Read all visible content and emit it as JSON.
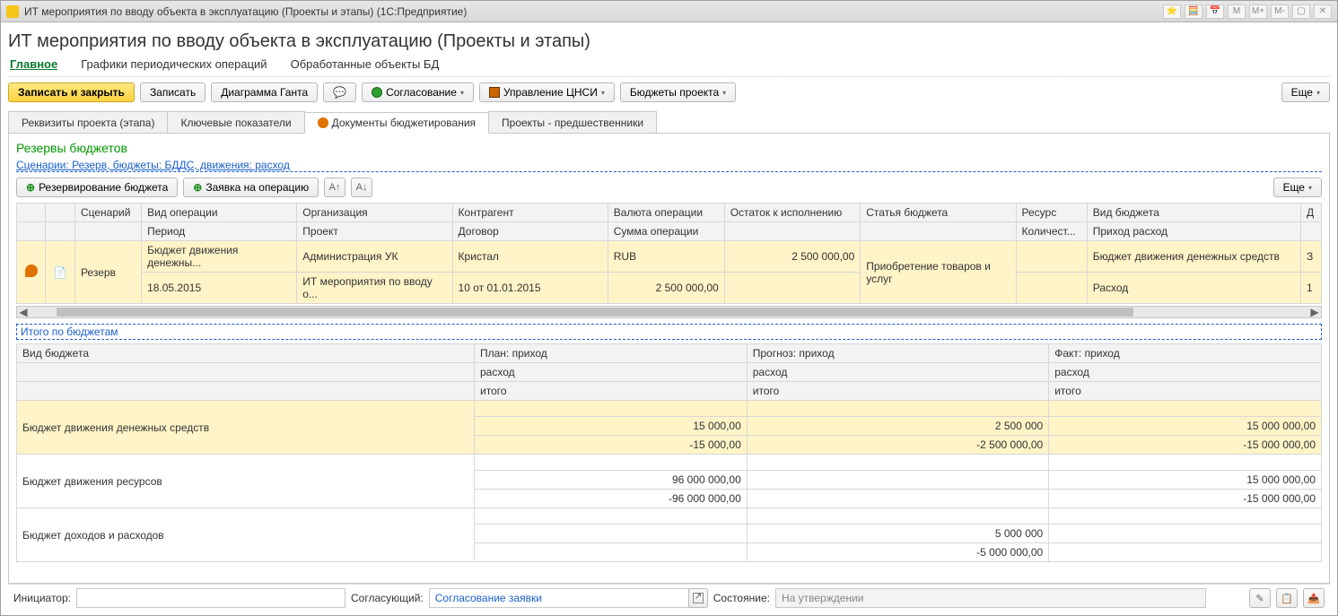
{
  "titlebar": {
    "appicon": "1c-icon",
    "title": "ИТ мероприятия по вводу объекта в эксплуатацию (Проекты и этапы)  (1С:Предприятие)",
    "buttons": [
      "⭐",
      "🧮",
      "📅",
      "M",
      "M+",
      "M-",
      "▢",
      "✕"
    ]
  },
  "page_title": "ИТ мероприятия по вводу объекта в эксплуатацию (Проекты и этапы)",
  "nav_tabs": [
    {
      "label": "Главное",
      "active": true
    },
    {
      "label": "Графики периодических операций",
      "active": false
    },
    {
      "label": "Обработанные объекты БД",
      "active": false
    }
  ],
  "toolbar": {
    "save_close": "Записать и закрыть",
    "save": "Записать",
    "gantt": "Диаграмма Ганта",
    "approval": "Согласование",
    "nsi": "Управление ЦНСИ",
    "budgets": "Бюджеты проекта",
    "more": "Еще"
  },
  "sub_tabs": [
    {
      "label": "Реквизиты проекта (этапа)",
      "active": false,
      "icon": false
    },
    {
      "label": "Ключевые показатели",
      "active": false,
      "icon": false
    },
    {
      "label": "Документы бюджетирования",
      "active": true,
      "icon": true
    },
    {
      "label": "Проекты - предшественники",
      "active": false,
      "icon": false
    }
  ],
  "reserves": {
    "title": "Резервы бюджетов",
    "filter_link": "Сценарии: Резерв, бюджеты: БДДС, движения: расход",
    "btn_reserve": "Резервирование бюджета",
    "btn_request": "Заявка на операцию",
    "more": "Еще"
  },
  "grid": {
    "headers_row1": [
      "",
      "",
      "Сценарий",
      "Вид операции",
      "Организация",
      "Контрагент",
      "Валюта операции",
      "Остаток к исполнению",
      "Статья бюджета",
      "Ресурс",
      "Вид бюджета",
      "Д"
    ],
    "headers_row2": [
      "",
      "",
      "",
      "Период",
      "Проект",
      "Договор",
      "Сумма операции",
      "",
      "",
      "Количест...",
      "Приход расход",
      ""
    ],
    "row_top": [
      "",
      "",
      "Резерв",
      "Бюджет движения денежны...",
      "Администрация УК",
      "Кристал",
      "RUB",
      "2 500 000,00",
      "Приобретение товаров и услуг",
      "",
      "Бюджет движения денежных средств",
      "З"
    ],
    "row_bot": [
      "",
      "",
      "",
      "18.05.2015",
      "ИТ мероприятия по вводу о...",
      "10 от 01.01.2015",
      "2 500 000,00",
      "",
      "",
      "",
      "Расход",
      "1"
    ]
  },
  "totals_link": "Итого по бюджетам",
  "summary": {
    "headers_row1": [
      "Вид бюджета",
      "План: приход",
      "Прогноз: приход",
      "Факт: приход"
    ],
    "headers_row2": [
      "",
      "расход",
      "расход",
      "расход"
    ],
    "headers_row3": [
      "",
      "итого",
      "итого",
      "итого"
    ],
    "rows": [
      {
        "label": "Бюджет движения денежных средств",
        "hl": true,
        "r1": [
          "",
          "",
          "",
          ""
        ],
        "r2": [
          "",
          "15 000,00",
          "2 500 000",
          "15 000 000,00"
        ],
        "r3": [
          "",
          "-15 000,00",
          "-2 500 000,00",
          "-15 000 000,00"
        ]
      },
      {
        "label": "Бюджет движения ресурсов",
        "hl": false,
        "r1": [
          "",
          "",
          "",
          ""
        ],
        "r2": [
          "",
          "96 000 000,00",
          "",
          "15 000 000,00"
        ],
        "r3": [
          "",
          "-96 000 000,00",
          "",
          "-15 000 000,00"
        ]
      },
      {
        "label": "Бюджет доходов и расходов",
        "hl": false,
        "r1": [
          "",
          "",
          "",
          ""
        ],
        "r2": [
          "",
          "",
          "5 000 000",
          ""
        ],
        "r3": [
          "",
          "",
          "-5 000 000,00",
          ""
        ]
      }
    ]
  },
  "footer": {
    "initiator_label": "Инициатор:",
    "initiator_value": "",
    "approver_label": "Согласующий:",
    "approver_value": "Согласование заявки",
    "state_label": "Состояние:",
    "state_value": "На утверждении"
  }
}
